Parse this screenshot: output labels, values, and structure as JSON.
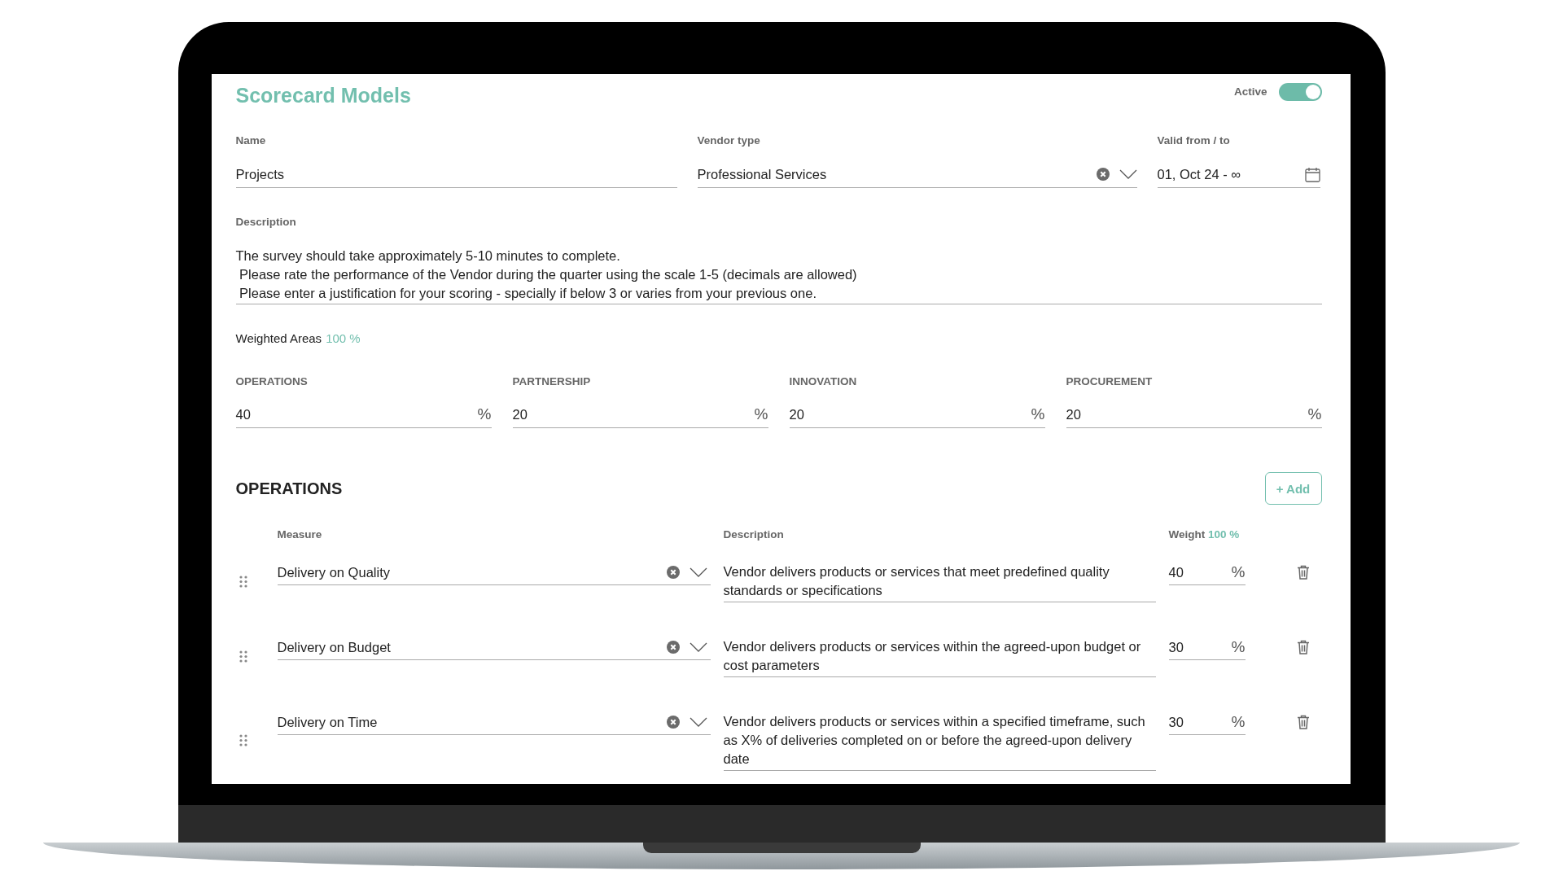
{
  "title": "Scorecard Models",
  "active_toggle": {
    "label": "Active",
    "on": true
  },
  "fields": [
    {
      "kind": "text",
      "label": "Name",
      "value": "Projects"
    },
    {
      "kind": "select",
      "label": "Vendor type",
      "value": "Professional Services"
    },
    {
      "kind": "date",
      "label": "Valid from / to",
      "value": "01, Oct 24 - ∞"
    }
  ],
  "description": {
    "label": "Description",
    "lines": [
      "The survey should take approximately 5-10 minutes to complete.",
      " Please rate the performance of the Vendor during the quarter using the scale 1-5 (decimals are allowed)",
      " Please enter a justification for your scoring - specially if below 3 or varies from your previous one."
    ]
  },
  "weighted_areas": {
    "label": "Weighted Areas",
    "total": "100 %",
    "areas": [
      {
        "label": "OPERATIONS",
        "value": "40",
        "unit": "%"
      },
      {
        "label": "PARTNERSHIP",
        "value": "20",
        "unit": "%"
      },
      {
        "label": "INNOVATION",
        "value": "20",
        "unit": "%"
      },
      {
        "label": "PROCUREMENT",
        "value": "20",
        "unit": "%"
      }
    ]
  },
  "section": {
    "title": "OPERATIONS",
    "add_button": "+ Add",
    "columns": {
      "measure": "Measure",
      "description": "Description",
      "weight": "Weight",
      "weight_total": "100 %"
    },
    "rows": [
      {
        "measure": "Delivery on Quality",
        "description": "Vendor delivers products or services that meet predefined quality standards or specifications",
        "weight": "40",
        "unit": "%"
      },
      {
        "measure": "Delivery on Budget",
        "description": "Vendor delivers products or services within the agreed-upon budget or cost parameters",
        "weight": "30",
        "unit": "%"
      },
      {
        "measure": "Delivery on Time",
        "description": "Vendor delivers products or services within a specified timeframe, such as X% of deliveries completed on or before the agreed-upon delivery date",
        "weight": "30",
        "unit": "%"
      }
    ]
  }
}
